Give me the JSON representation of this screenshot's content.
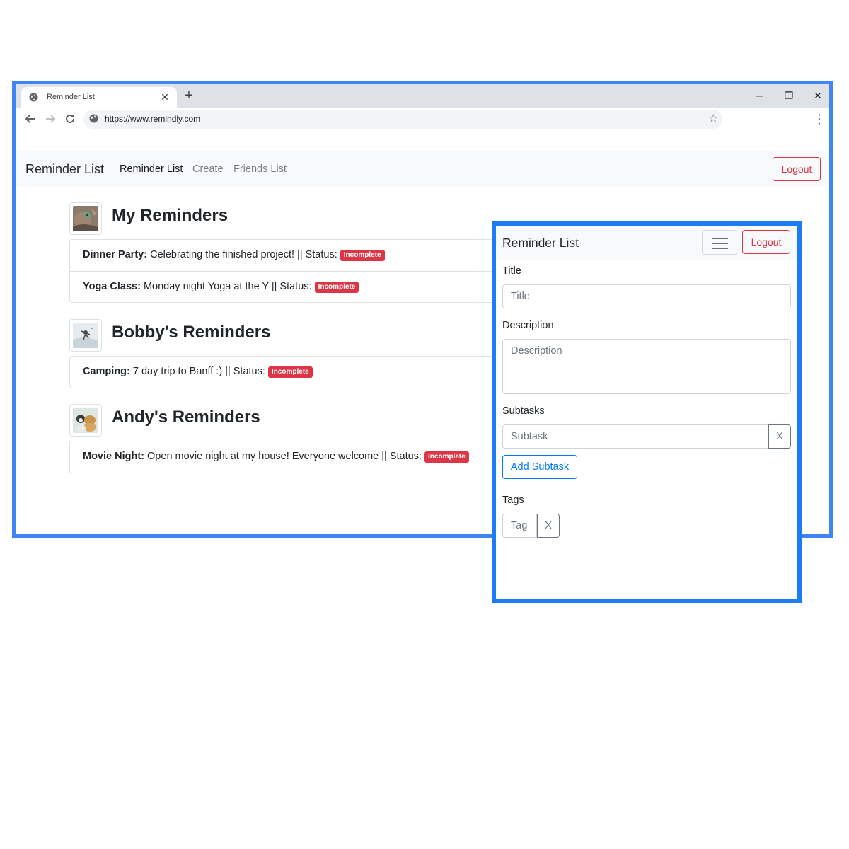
{
  "browser": {
    "tab_title": "Reminder List",
    "tab_close": "✕",
    "new_tab": "+",
    "url": "https://www.remindly.com",
    "window_controls": {
      "minimize": "─",
      "restore": "❐",
      "close": "✕"
    }
  },
  "page": {
    "brand": "Reminder List",
    "nav": [
      {
        "label": "Reminder List",
        "active": true
      },
      {
        "label": "Create",
        "active": false
      },
      {
        "label": "Friends List",
        "active": false
      }
    ],
    "logout_label": "Logout",
    "sections": [
      {
        "title": "My Reminders",
        "avatar": "cat-avatar",
        "items": [
          {
            "title": "Dinner Party:",
            "description": "Celebrating the finished project! || Status:",
            "status": "Incomplete"
          },
          {
            "title": "Yoga Class:",
            "description": "Monday night Yoga at the Y || Status:",
            "status": "Incomplete"
          }
        ]
      },
      {
        "title": "Bobby's Reminders",
        "avatar": "snow-avatar",
        "items": [
          {
            "title": "Camping:",
            "description": "7 day trip to Banff :) || Status:",
            "status": "Incomplete"
          }
        ]
      },
      {
        "title": "Andy's Reminders",
        "avatar": "pets-avatar",
        "items": [
          {
            "title": "Movie Night:",
            "description": "Open movie night at my house! Everyone welcome || Status:",
            "status": "Incomplete"
          }
        ]
      }
    ]
  },
  "mobile": {
    "brand": "Reminder List",
    "logout_label": "Logout",
    "form": {
      "title_label": "Title",
      "title_placeholder": "Title",
      "description_label": "Description",
      "description_placeholder": "Description",
      "subtasks_label": "Subtasks",
      "subtask_placeholder": "Subtask",
      "remove_label": "X",
      "add_subtask_label": "Add Subtask",
      "tags_label": "Tags",
      "tag_placeholder": "Tag"
    }
  },
  "colors": {
    "frame_blue": "#3f85f4",
    "overlay_blue": "#1b7cf3",
    "danger": "#dc3545",
    "primary": "#007bff"
  }
}
